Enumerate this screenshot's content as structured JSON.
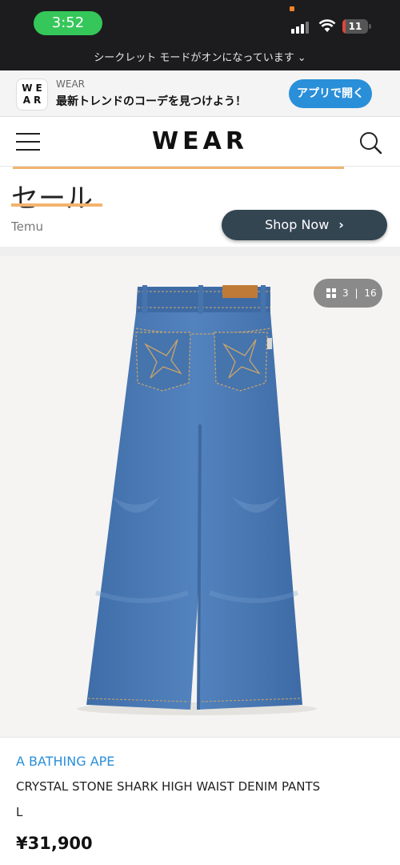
{
  "status_bar": {
    "time": "3:52",
    "battery_level": "11",
    "icons": [
      "signal-icon",
      "wifi-icon",
      "battery-icon"
    ]
  },
  "private_bar": {
    "text": "シークレット モードがオンになっています",
    "chevron_icon": "chevron-down-icon"
  },
  "app_banner": {
    "logo_text": "WEAR",
    "app_name": "WEAR",
    "tagline": "最新トレンドのコーデを見つけよう！",
    "open_button": "アプリで開く",
    "accent_color": "#2a8fd9"
  },
  "header": {
    "logo": "WEAR",
    "menu_icon": "hamburger-icon",
    "search_icon": "search-icon"
  },
  "ad": {
    "title": "セール",
    "sponsor": "Temu",
    "cta": "Shop Now",
    "accent_color": "#f3b36f"
  },
  "gallery": {
    "current": "3",
    "separator": "|",
    "total": "16",
    "icon": "grid-icon"
  },
  "product": {
    "brand": "A BATHING APE",
    "name": "CRYSTAL STONE SHARK HIGH WAIST DENIM PANTS",
    "size": "L",
    "price": "¥31,900"
  }
}
